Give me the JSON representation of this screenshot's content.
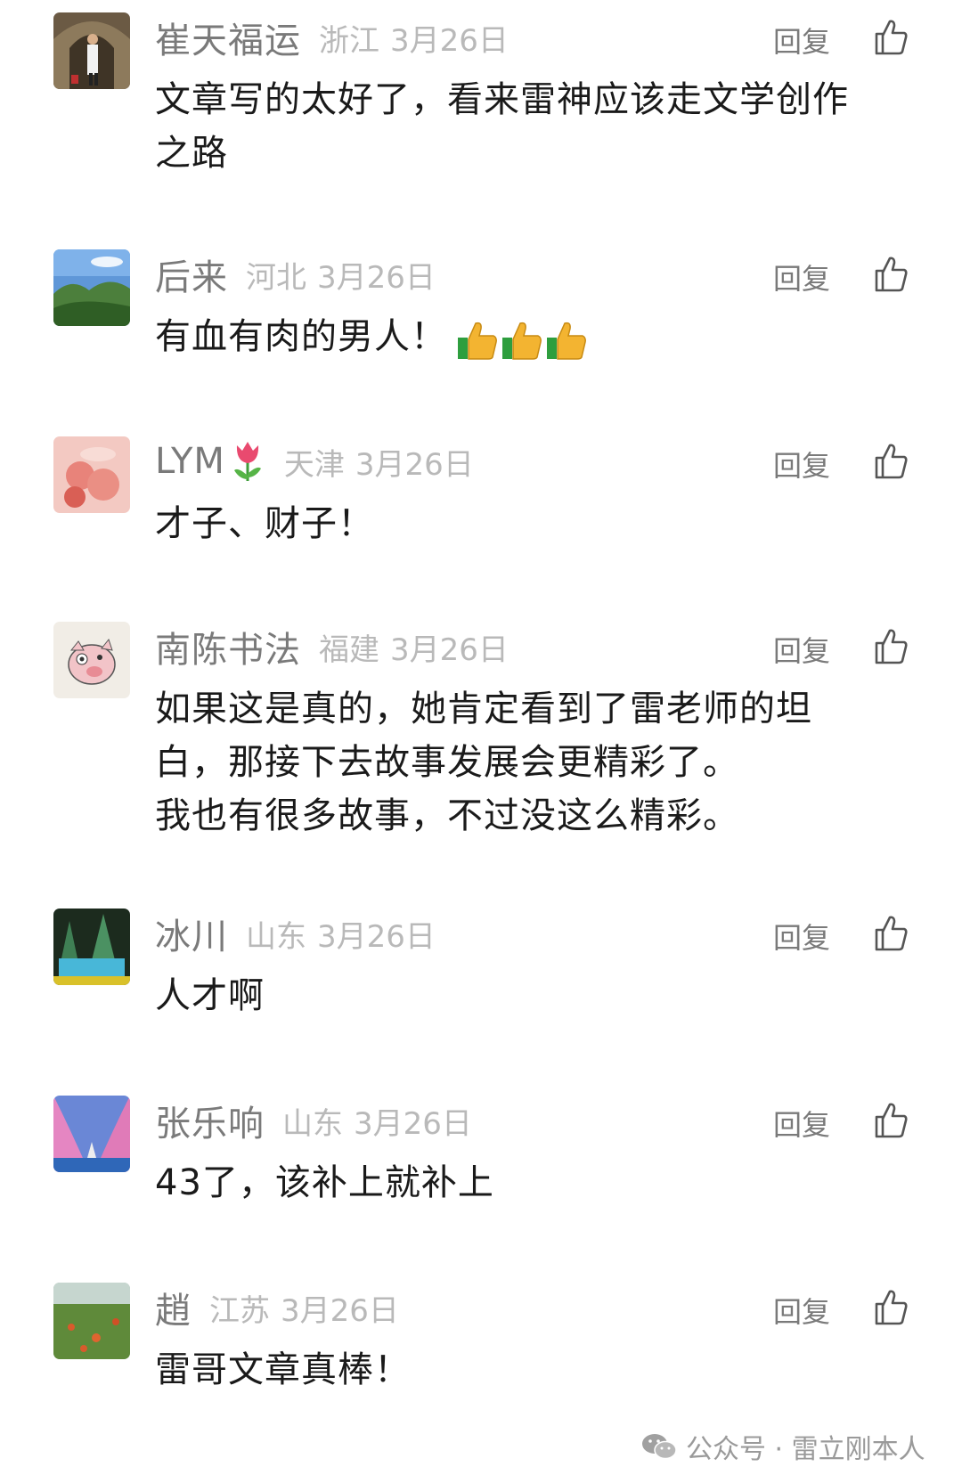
{
  "comments": [
    {
      "name": "崔天福运",
      "location": "浙江",
      "date": "3月26日",
      "lines": [
        "文章写的太好了，看来雷神应该走文学创作",
        "之路"
      ],
      "reply_label": "回复"
    },
    {
      "name": "后来",
      "location": "河北",
      "date": "3月26日",
      "lines": [
        "有血有肉的男人！"
      ],
      "emoji": "thumbs-up x3",
      "reply_label": "回复"
    },
    {
      "name": "LYM",
      "name_emoji": "tulip",
      "location": "天津",
      "date": "3月26日",
      "lines": [
        "才子、财子！"
      ],
      "reply_label": "回复"
    },
    {
      "name": "南陈书法",
      "location": "福建",
      "date": "3月26日",
      "lines": [
        "如果这是真的，她肯定看到了雷老师的坦",
        "白，那接下去故事发展会更精彩了。",
        "我也有很多故事，不过没这么精彩。"
      ],
      "reply_label": "回复"
    },
    {
      "name": "冰川",
      "location": "山东",
      "date": "3月26日",
      "lines": [
        "人才啊"
      ],
      "reply_label": "回复"
    },
    {
      "name": "张乐响",
      "location": "山东",
      "date": "3月26日",
      "lines": [
        "43了，该补上就补上"
      ],
      "reply_label": "回复"
    },
    {
      "name": "趙",
      "location": "江苏",
      "date": "3月26日",
      "lines": [
        "雷哥文章真棒！"
      ],
      "reply_label": "回复"
    }
  ],
  "watermark": {
    "text": "公众号 · 雷立刚本人",
    "icon": "wechat-icon"
  },
  "colors": {
    "name": "#7a7a7a",
    "meta": "#b9b9b9",
    "body": "#1a1a1a",
    "background": "#ffffff"
  }
}
